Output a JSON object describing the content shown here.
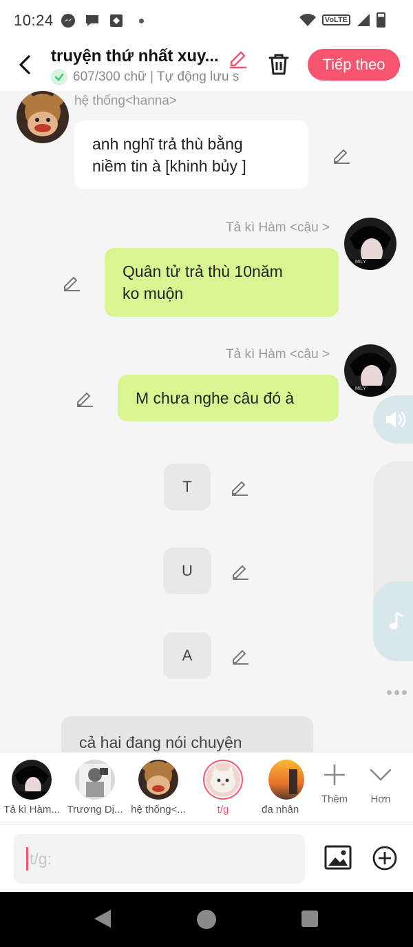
{
  "status_bar": {
    "time": "10:24",
    "left_icons": [
      "messenger-icon",
      "chat-bubble-icon",
      "game-icon",
      "dot-icon"
    ],
    "right_icons": [
      "wifi-icon",
      "volte-icon",
      "signal-icon",
      "battery-icon"
    ],
    "volte_label": "VoLTE"
  },
  "header": {
    "title": "truyện thứ nhất xuy...",
    "subtitle": "607/300 chữ | Tự động lưu s",
    "next_label": "Tiếp theo"
  },
  "messages": [
    {
      "sender": "hệ thống<hanna>",
      "text_line1": "anh nghĩ trả thù bằng",
      "text_line2": "niềm tin à [khinh bủy ]"
    },
    {
      "sender": "Tả kì Hàm <cậu >",
      "text_line1": "Quân tử trả thù 10năm",
      "text_line2": "ko muộn"
    },
    {
      "sender": "Tả kì Hàm <cậu >",
      "text": "M chưa nghe câu đó à"
    },
    {
      "text": "T"
    },
    {
      "text": "U"
    },
    {
      "text": "A"
    },
    {
      "text": "cả hai đang nói chuyện"
    }
  ],
  "characters": [
    {
      "label": "Tả kì Hàm..."
    },
    {
      "label": "Trương Dị..."
    },
    {
      "label": "hệ thống<..."
    },
    {
      "label": "t/g",
      "selected": true
    },
    {
      "label": "đa nhân"
    }
  ],
  "bar_buttons": {
    "add_label": "Thêm",
    "more_label": "Hơn"
  },
  "input": {
    "placeholder": "t/g:"
  },
  "colors": {
    "accent": "#f5556e",
    "green_bubble": "#d9f592",
    "check": "#2ecc71"
  }
}
